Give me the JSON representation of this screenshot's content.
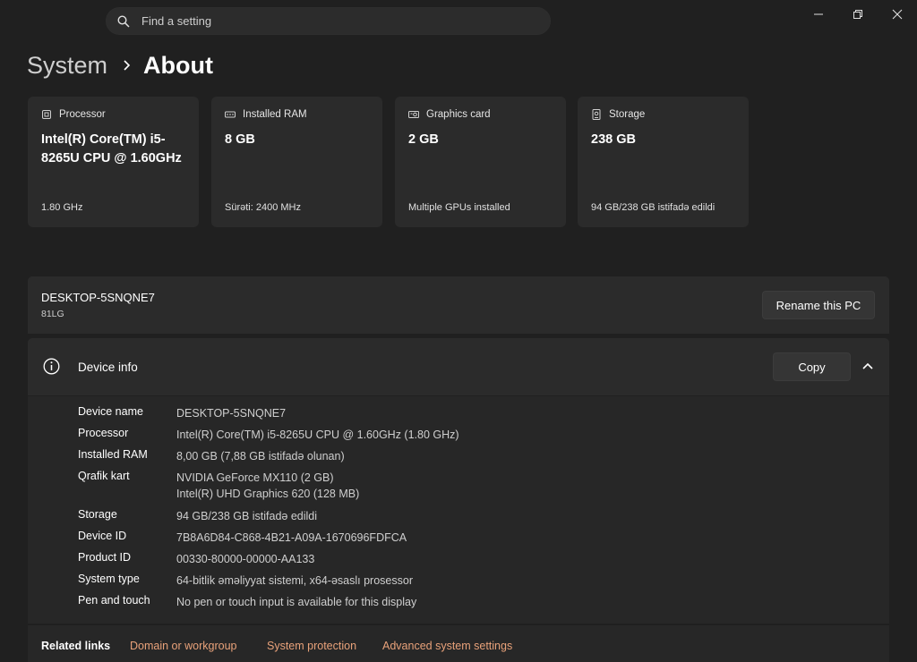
{
  "titlebar": {
    "search_placeholder": "Find a setting",
    "minimize_icon": "minimize-icon",
    "restore_icon": "restore-icon",
    "close_icon": "close-icon"
  },
  "breadcrumb": {
    "root": "System",
    "current": "About"
  },
  "cards": [
    {
      "icon": "processor-icon",
      "label": "Processor",
      "value": "Intel(R) Core(TM) i5-8265U CPU @ 1.60GHz",
      "sub": "1.80 GHz"
    },
    {
      "icon": "ram-icon",
      "label": "Installed RAM",
      "value": "8 GB",
      "sub": "Sürəti: 2400 MHz"
    },
    {
      "icon": "graphics-card-icon",
      "label": "Graphics card",
      "value": "2 GB",
      "sub": "Multiple GPUs installed"
    },
    {
      "icon": "storage-icon",
      "label": "Storage",
      "value": "238 GB",
      "sub": "94 GB/238 GB istifadə edildi"
    }
  ],
  "pc": {
    "name": "DESKTOP-5SNQNE7",
    "model": "81LG",
    "rename_label": "Rename this PC"
  },
  "device_info": {
    "title": "Device info",
    "copy_label": "Copy",
    "rows": [
      {
        "label": "Device name",
        "value": "DESKTOP-5SNQNE7",
        "value2": ""
      },
      {
        "label": "Processor",
        "value": "Intel(R) Core(TM) i5-8265U CPU @ 1.60GHz (1.80 GHz)",
        "value2": ""
      },
      {
        "label": "Installed RAM",
        "value": "8,00 GB (7,88 GB istifadə olunan)",
        "value2": ""
      },
      {
        "label": "Qrafik kart",
        "value": "NVIDIA GeForce MX110 (2 GB)",
        "value2": "Intel(R) UHD Graphics 620 (128 MB)"
      },
      {
        "label": "Storage",
        "value": "94 GB/238 GB istifadə edildi",
        "value2": ""
      },
      {
        "label": "Device ID",
        "value": "7B8A6D84-C868-4B21-A09A-1670696FDFCA",
        "value2": ""
      },
      {
        "label": "Product ID",
        "value": "00330-80000-00000-AA133",
        "value2": ""
      },
      {
        "label": "System type",
        "value": "64-bitlik əməliyyat sistemi, x64-əsaslı prosessor",
        "value2": ""
      },
      {
        "label": "Pen and touch",
        "value": "No pen or touch input is available for this display",
        "value2": ""
      }
    ]
  },
  "related": {
    "title": "Related links",
    "links": [
      "Domain or workgroup",
      "System protection",
      "Advanced system settings"
    ]
  },
  "colors": {
    "background": "#202020",
    "card": "#2b2b2b",
    "link": "#e9a27a"
  }
}
